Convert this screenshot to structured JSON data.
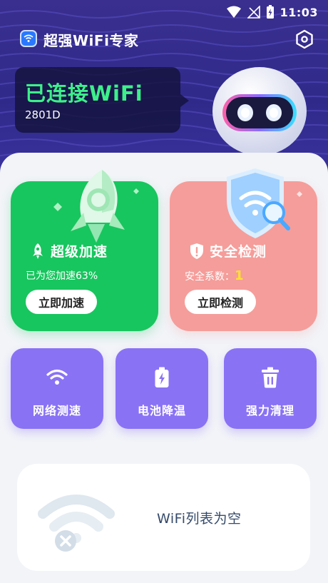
{
  "status_bar": {
    "time": "11:03"
  },
  "app": {
    "title": "超强WiFi专家"
  },
  "connection": {
    "status": "已连接WiFi",
    "ssid": "2801D"
  },
  "cards": {
    "speed": {
      "title": "超级加速",
      "subtitle": "已为您加速63%",
      "button": "立即加速"
    },
    "check": {
      "title": "安全检测",
      "subtitle_label": "安全系数：",
      "subtitle_value": "1",
      "button": "立即检测"
    }
  },
  "tools": [
    {
      "label": "网络测速",
      "icon": "wifi-icon"
    },
    {
      "label": "电池降温",
      "icon": "battery-icon"
    },
    {
      "label": "强力清理",
      "icon": "trash-icon"
    }
  ],
  "wifi_list": {
    "empty_text": "WiFi列表为空"
  },
  "colors": {
    "hero_bg": "#3a2f8f",
    "connected_green": "#3df08a",
    "speed_card": "#17c65e",
    "check_card": "#f59d9a",
    "tool_card": "#8a72f5",
    "score_yellow": "#ffe033"
  }
}
